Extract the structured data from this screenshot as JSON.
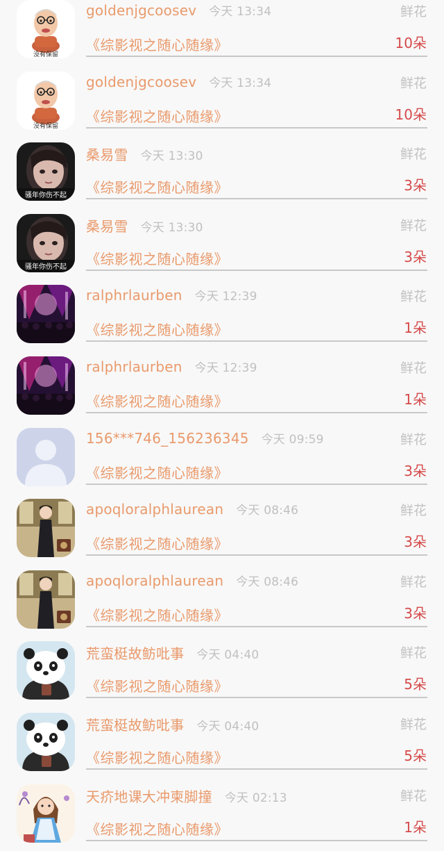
{
  "records": [
    {
      "username": "goldenjgcoosev",
      "time": "今天 13:34",
      "gift_type": "鲜花",
      "group": "《综影视之随心随缘》",
      "count": "10朵",
      "avatar": {
        "icon": "cartoon-grandpa",
        "caption": "没有保留"
      }
    },
    {
      "username": "goldenjgcoosev",
      "time": "今天 13:34",
      "gift_type": "鲜花",
      "group": "《综影视之随心随缘》",
      "count": "10朵",
      "avatar": {
        "icon": "cartoon-grandpa",
        "caption": "没有保留"
      }
    },
    {
      "username": "桑易雪",
      "time": "今天 13:30",
      "gift_type": "鲜花",
      "group": "《综影视之随心随缘》",
      "count": "3朵",
      "avatar": {
        "icon": "girl-photo",
        "caption": "骚年你伤不起"
      }
    },
    {
      "username": "桑易雪",
      "time": "今天 13:30",
      "gift_type": "鲜花",
      "group": "《综影视之随心随缘》",
      "count": "3朵",
      "avatar": {
        "icon": "girl-photo",
        "caption": "骚年你伤不起"
      }
    },
    {
      "username": "ralphrlaurben",
      "time": "今天 12:39",
      "gift_type": "鲜花",
      "group": "《综影视之随心随缘》",
      "count": "1朵",
      "avatar": {
        "icon": "concert-photo",
        "caption": ""
      }
    },
    {
      "username": "ralphrlaurben",
      "time": "今天 12:39",
      "gift_type": "鲜花",
      "group": "《综影视之随心随缘》",
      "count": "1朵",
      "avatar": {
        "icon": "concert-photo",
        "caption": ""
      }
    },
    {
      "username": "156***746_156236345",
      "time": "今天 09:59",
      "gift_type": "鲜花",
      "group": "《综影视之随心随缘》",
      "count": "3朵",
      "avatar": {
        "icon": "default-user",
        "caption": ""
      }
    },
    {
      "username": "apoqloralphlaurean",
      "time": "今天 08:46",
      "gift_type": "鲜花",
      "group": "《综影视之随心随缘》",
      "count": "3朵",
      "avatar": {
        "icon": "qipao-woman",
        "caption": ""
      }
    },
    {
      "username": "apoqloralphlaurean",
      "time": "今天 08:46",
      "gift_type": "鲜花",
      "group": "《综影视之随心随缘》",
      "count": "3朵",
      "avatar": {
        "icon": "qipao-woman",
        "caption": ""
      }
    },
    {
      "username": "荒蛮梃故鲂吡事",
      "time": "今天 04:40",
      "gift_type": "鲜花",
      "group": "《综影视之随心随缘》",
      "count": "5朵",
      "avatar": {
        "icon": "panda-cartoon",
        "caption": ""
      }
    },
    {
      "username": "荒蛮梃故鲂吡事",
      "time": "今天 04:40",
      "gift_type": "鲜花",
      "group": "《综影视之随心随缘》",
      "count": "5朵",
      "avatar": {
        "icon": "panda-cartoon",
        "caption": ""
      }
    },
    {
      "username": "天疥地课大冲柬脚撞",
      "time": "今天 02:13",
      "gift_type": "鲜花",
      "group": "《综影视之随心随缘》",
      "count": "1朵",
      "avatar": {
        "icon": "alice-cartoon",
        "caption": ""
      }
    }
  ]
}
